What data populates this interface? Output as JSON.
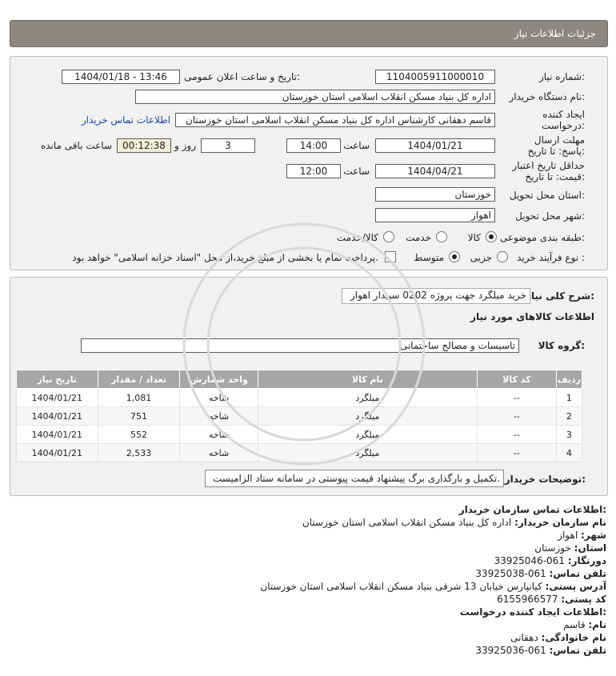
{
  "header": {
    "title": "جزئیات اطلاعات نیاز"
  },
  "need": {
    "number_label": "شماره نیاز:",
    "number": "1104005911000010",
    "announce_label": "تاریخ و ساعت اعلان عمومی:",
    "announce": "1404/01/18 - 13:46",
    "buyer_label": "نام دستگاه خریدار:",
    "buyer": "اداره کل بنیاد مسکن انقلاب اسلامی استان خوزستان",
    "creator_label": "ایجاد کننده درخواست:",
    "creator": "قاسم دهقانی کارشناس اداره کل بنیاد مسکن انقلاب اسلامی استان خوزستان",
    "contact_link": "اطلاعات تماس خریدار",
    "deadline_label": "مهلت ارسال پاسخ: تا تاریخ:",
    "deadline_date": "1404/01/21",
    "time_label": "ساعت",
    "deadline_time": "14:00",
    "days": "3",
    "days_label": "روز و",
    "remaining": "00:12:38",
    "remaining_label": "ساعت باقی مانده",
    "validity_label": "حداقل تاریخ اعتبار قیمت: تا تاریخ:",
    "validity_date": "1404/04/21",
    "validity_time": "12:00",
    "province_label": "استان محل تحویل:",
    "province": "خوزستان",
    "city_label": "شهر محل تحویل:",
    "city": "اهواز",
    "category_label": "طبقه بندی موضوعی:",
    "category_options": [
      "کالا",
      "خدمت",
      "کالا/خدمت"
    ],
    "process_label": "نوع فرآیند خرید :",
    "process_options": [
      "جزیی",
      "متوسط"
    ],
    "payment_note": "پرداخت تمام یا بخشی از مبلغ خرید،از محل \"اسناد خزانه اسلامی\" خواهد بود."
  },
  "summary": {
    "desc_label": "شرح کلی نیاز:",
    "desc": "خرید میلگرد جهت پروژه 0202 سپیدار اهواز",
    "goods_title": "اطلاعات کالاهای مورد نیاز",
    "group_label": "گروه کالا:",
    "group": "تاسیسات و مصالح ساختمانی",
    "columns": [
      "ردیف",
      "کد کالا",
      "نام کالا",
      "واحد شمارش",
      "تعداد / مقدار",
      "تاریخ نیاز"
    ],
    "rows": [
      [
        "1",
        "--",
        "میلگرد",
        "شاخه",
        "1,081",
        "1404/01/21"
      ],
      [
        "2",
        "--",
        "میلگرد",
        "شاخه",
        "751",
        "1404/01/21"
      ],
      [
        "3",
        "--",
        "میلگرد",
        "شاخه",
        "552",
        "1404/01/21"
      ],
      [
        "4",
        "--",
        "میلگرد",
        "شاخه",
        "2,533",
        "1404/01/21"
      ]
    ],
    "buyer_notes_label": "توضیحات خریدار:",
    "buyer_notes": "تکمیل و بارگذاری برگ پیشنهاد قیمت پیوستی در سامانه ستاد الزامیست."
  },
  "contact": {
    "title": "اطلاعات تماس سازمان خریدار:",
    "org_label": "نام سازمان خریدار:",
    "org": "اداره کل بنیاد مسکن انقلاب اسلامی استان خوزستان",
    "city_label": "شهر:",
    "city": "اهواز",
    "province_label": "استان:",
    "province": "خوزستان",
    "fax_label": "دورنگار:",
    "fax": "061-33925046",
    "phone_label": "تلفن تماس:",
    "phone": "061-33925038",
    "address_label": "آدرس پستی:",
    "address": "کیانپارس خیابان 13 شرقی بنیاد مسکن انقلاب اسلامی استان خوزستان",
    "postal_label": "کد پستی:",
    "postal": "6155966577",
    "creator_title": "اطلاعات ایجاد کننده درخواست:",
    "name_label": "نام:",
    "name": "قاسم",
    "family_label": "نام خانوادگی:",
    "family": "دهقانی",
    "creator_phone_label": "تلفن تماس:",
    "creator_phone": "061-33925036"
  },
  "colors": {
    "header_bg": "#8c8780",
    "table_header": "#a6a6a6",
    "link": "#1e49a6"
  }
}
